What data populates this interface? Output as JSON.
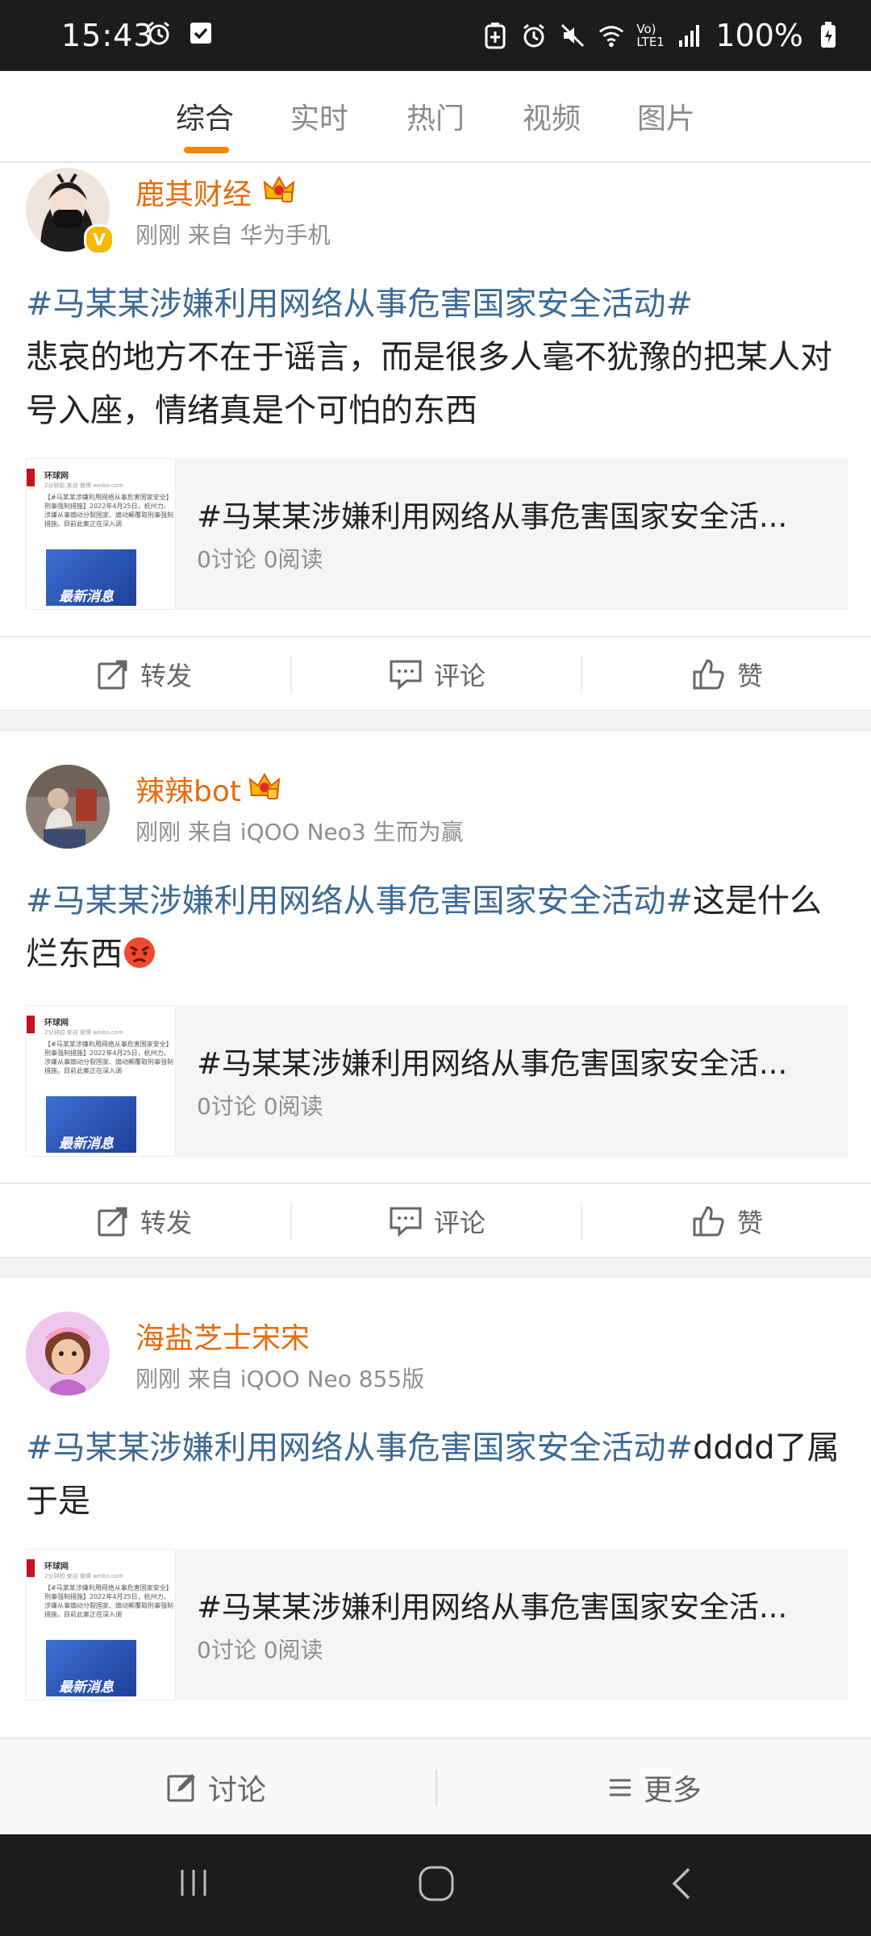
{
  "status_bar": {
    "time": "15:43",
    "battery": "100%",
    "network": "Vo) LTE1"
  },
  "tabs": [
    {
      "label": "综合",
      "active": true
    },
    {
      "label": "实时",
      "active": false
    },
    {
      "label": "热门",
      "active": false
    },
    {
      "label": "视频",
      "active": false
    },
    {
      "label": "图片",
      "active": false
    }
  ],
  "posts": [
    {
      "username": "鹿其财经",
      "meta": "刚刚 来自 华为手机",
      "hashtag": "#马某某涉嫌利用网络从事危害国家安全活动#",
      "text": "悲哀的地方不在于谣言，而是很多人毫不犹豫的把某人对号入座，情绪真是个可怕的东西",
      "card": {
        "title": "#马某某涉嫌利用网络从事危害国家安全活...",
        "stats": "0讨论 0阅读",
        "thumb_source": "环球网",
        "thumb_meta": "2分钟前 来自 微博 weibo.com",
        "thumb_text": "【#马某某涉嫌利用网络从事危害国家安全】刑事强制措施】2022年4月25日，杭州力，涉嫌从事煽动分裂国家、煽动颠覆取刑事强制措施。目前此案正在深入调",
        "thumb_banner": "最新消息"
      },
      "actions": {
        "repost": "转发",
        "comment": "评论",
        "like": "赞"
      }
    },
    {
      "username": "辣辣bot",
      "meta": "刚刚 来自 iQOO Neo3 生而为赢",
      "hashtag": "#马某某涉嫌利用网络从事危害国家安全活动#",
      "text": "这是什么烂东西",
      "card": {
        "title": "#马某某涉嫌利用网络从事危害国家安全活...",
        "stats": "0讨论 0阅读",
        "thumb_source": "环球网",
        "thumb_meta": "2分钟前 来自 微博 weibo.com",
        "thumb_text": "【#马某某涉嫌利用网络从事危害国家安全】刑事强制措施】2022年4月25日，杭州力，涉嫌从事煽动分裂国家、煽动颠覆取刑事强制措施。目前此案正在深入调",
        "thumb_banner": "最新消息"
      },
      "actions": {
        "repost": "转发",
        "comment": "评论",
        "like": "赞"
      }
    },
    {
      "username": "海盐芝士宋宋",
      "meta": "刚刚 来自 iQOO Neo 855版",
      "hashtag": "#马某某涉嫌利用网络从事危害国家安全活动#",
      "text": "dddd了属于是",
      "card": {
        "title": "#马某某涉嫌利用网络从事危害国家安全活...",
        "stats": "0讨论 0阅读",
        "thumb_source": "环球网",
        "thumb_meta": "2分钟前 来自 微博 weibo.com",
        "thumb_text": "【#马某某涉嫌利用网络从事危害国家安全】刑事强制措施】2022年4月25日，杭州力，涉嫌从事煽动分裂国家、煽动颠覆取刑事强制措施。目前此案正在深入调",
        "thumb_banner": "最新消息"
      }
    }
  ],
  "bottom_bar": {
    "discuss": "讨论",
    "more": "更多"
  },
  "colors": {
    "accent": "#ff8200",
    "username": "#e86b0c",
    "hashtag": "#3d6a96"
  }
}
